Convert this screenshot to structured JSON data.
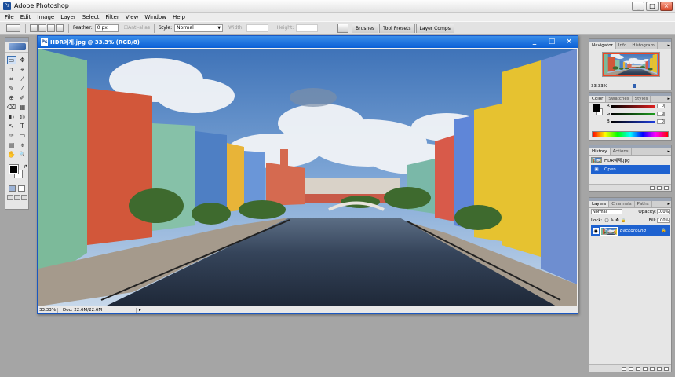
{
  "app": {
    "title": "Adobe Photoshop",
    "window_controls": [
      "_",
      "□",
      "×"
    ]
  },
  "menu": [
    "File",
    "Edit",
    "Image",
    "Layer",
    "Select",
    "Filter",
    "View",
    "Window",
    "Help"
  ],
  "options": {
    "feather_label": "Feather:",
    "feather_value": "0 px",
    "antialias_label": "Anti-alias",
    "style_label": "Style:",
    "style_value": "Normal",
    "width_label": "Width:",
    "height_label": "Height:"
  },
  "palette_well": [
    "Brushes",
    "Tool Presets",
    "Layer Comps"
  ],
  "toolbox": {
    "tools": [
      "▭",
      "✥",
      "ↄ",
      "⌖",
      "⌗",
      "⁄",
      "✎",
      "⁄",
      "⊕",
      "✐",
      "⌫",
      "▦",
      "◐",
      "◍",
      "↖",
      "T",
      "✑",
      "▭",
      "▤",
      "⌽",
      "✋",
      "🔍"
    ]
  },
  "document": {
    "title": "HDR예제.jpg @ 33.3% (RGB/8)",
    "status_zoom": "33.33%",
    "status_info": "Doc: 22.6M/22.6M",
    "status_arrow": "▸"
  },
  "navigator": {
    "tabs": [
      "Navigator",
      "Info",
      "Histogram"
    ],
    "zoom": "33.33%"
  },
  "color": {
    "tabs": [
      "Color",
      "Swatches",
      "Styles"
    ],
    "channels": [
      {
        "label": "R",
        "value": "0",
        "color": "#e02020"
      },
      {
        "label": "G",
        "value": "0",
        "color": "#20a020"
      },
      {
        "label": "B",
        "value": "0",
        "color": "#2040e0"
      }
    ]
  },
  "history": {
    "tabs": [
      "History",
      "Actions"
    ],
    "items": [
      "HDR예제.jpg",
      "Open"
    ]
  },
  "layers": {
    "tabs": [
      "Layers",
      "Channels",
      "Paths"
    ],
    "blend_mode": "Normal",
    "opacity_label": "Opacity:",
    "opacity_value": "100%",
    "lock_label": "Lock:",
    "fill_label": "Fill:",
    "fill_value": "100%",
    "layer_name": "Background"
  }
}
